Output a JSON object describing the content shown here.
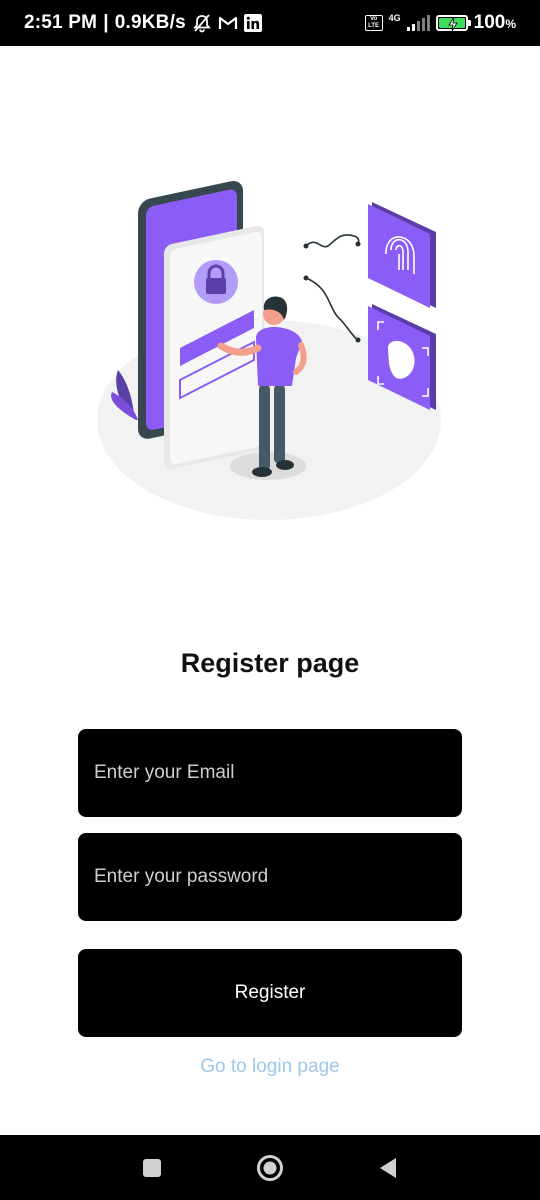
{
  "status_bar": {
    "time": "2:51 PM",
    "speed": "0.9KB/s",
    "network": "4G",
    "volte": "Vo LTE",
    "battery": "100",
    "battery_unit": "%",
    "separator": "|",
    "icons": [
      "mute-icon",
      "gmail-icon",
      "linkedin-icon",
      "volte-icon",
      "signal-icon",
      "battery-charging-icon"
    ]
  },
  "colors": {
    "accent": "#8b5cf6",
    "field_background": "#000000",
    "link": "#9cc9e8"
  },
  "page": {
    "title": "Register page"
  },
  "form": {
    "email_placeholder": "Enter your Email",
    "email_value": "",
    "password_placeholder": "Enter your password",
    "password_value": "",
    "register_label": "Register",
    "login_link": "Go to login page"
  },
  "nav_bar": {
    "icons": [
      "recents-square-icon",
      "home-circle-icon",
      "back-triangle-icon"
    ]
  }
}
